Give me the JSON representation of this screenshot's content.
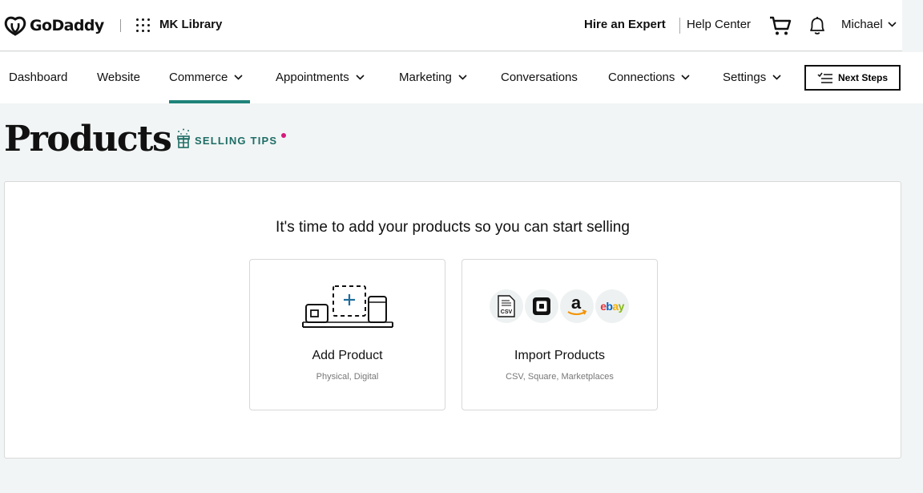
{
  "header": {
    "brand": "GoDaddy",
    "site_name": "MK Library",
    "hire_expert": "Hire an Expert",
    "help_center": "Help Center",
    "user_name": "Michael"
  },
  "nav": {
    "items": [
      {
        "label": "Dashboard"
      },
      {
        "label": "Website"
      },
      {
        "label": "Commerce"
      },
      {
        "label": "Appointments"
      },
      {
        "label": "Marketing"
      },
      {
        "label": "Conversations"
      },
      {
        "label": "Connections"
      },
      {
        "label": "Settings"
      }
    ],
    "active": "Commerce",
    "next_steps": "Next Steps"
  },
  "page": {
    "title": "Products",
    "selling_tips": "SELLING TIPS"
  },
  "main": {
    "headline": "It's time to add your products so you can start selling",
    "tiles": [
      {
        "title": "Add Product",
        "subtitle": "Physical, Digital"
      },
      {
        "title": "Import Products",
        "subtitle": "CSV, Square, Marketplaces"
      }
    ],
    "import_badges": [
      "CSV",
      "Square",
      "Amazon",
      "ebay"
    ]
  },
  "colors": {
    "accent": "#1e837a",
    "tips_text": "#1e6d66",
    "notification_dot": "#d6197a",
    "page_bg": "#f2f5f5"
  }
}
